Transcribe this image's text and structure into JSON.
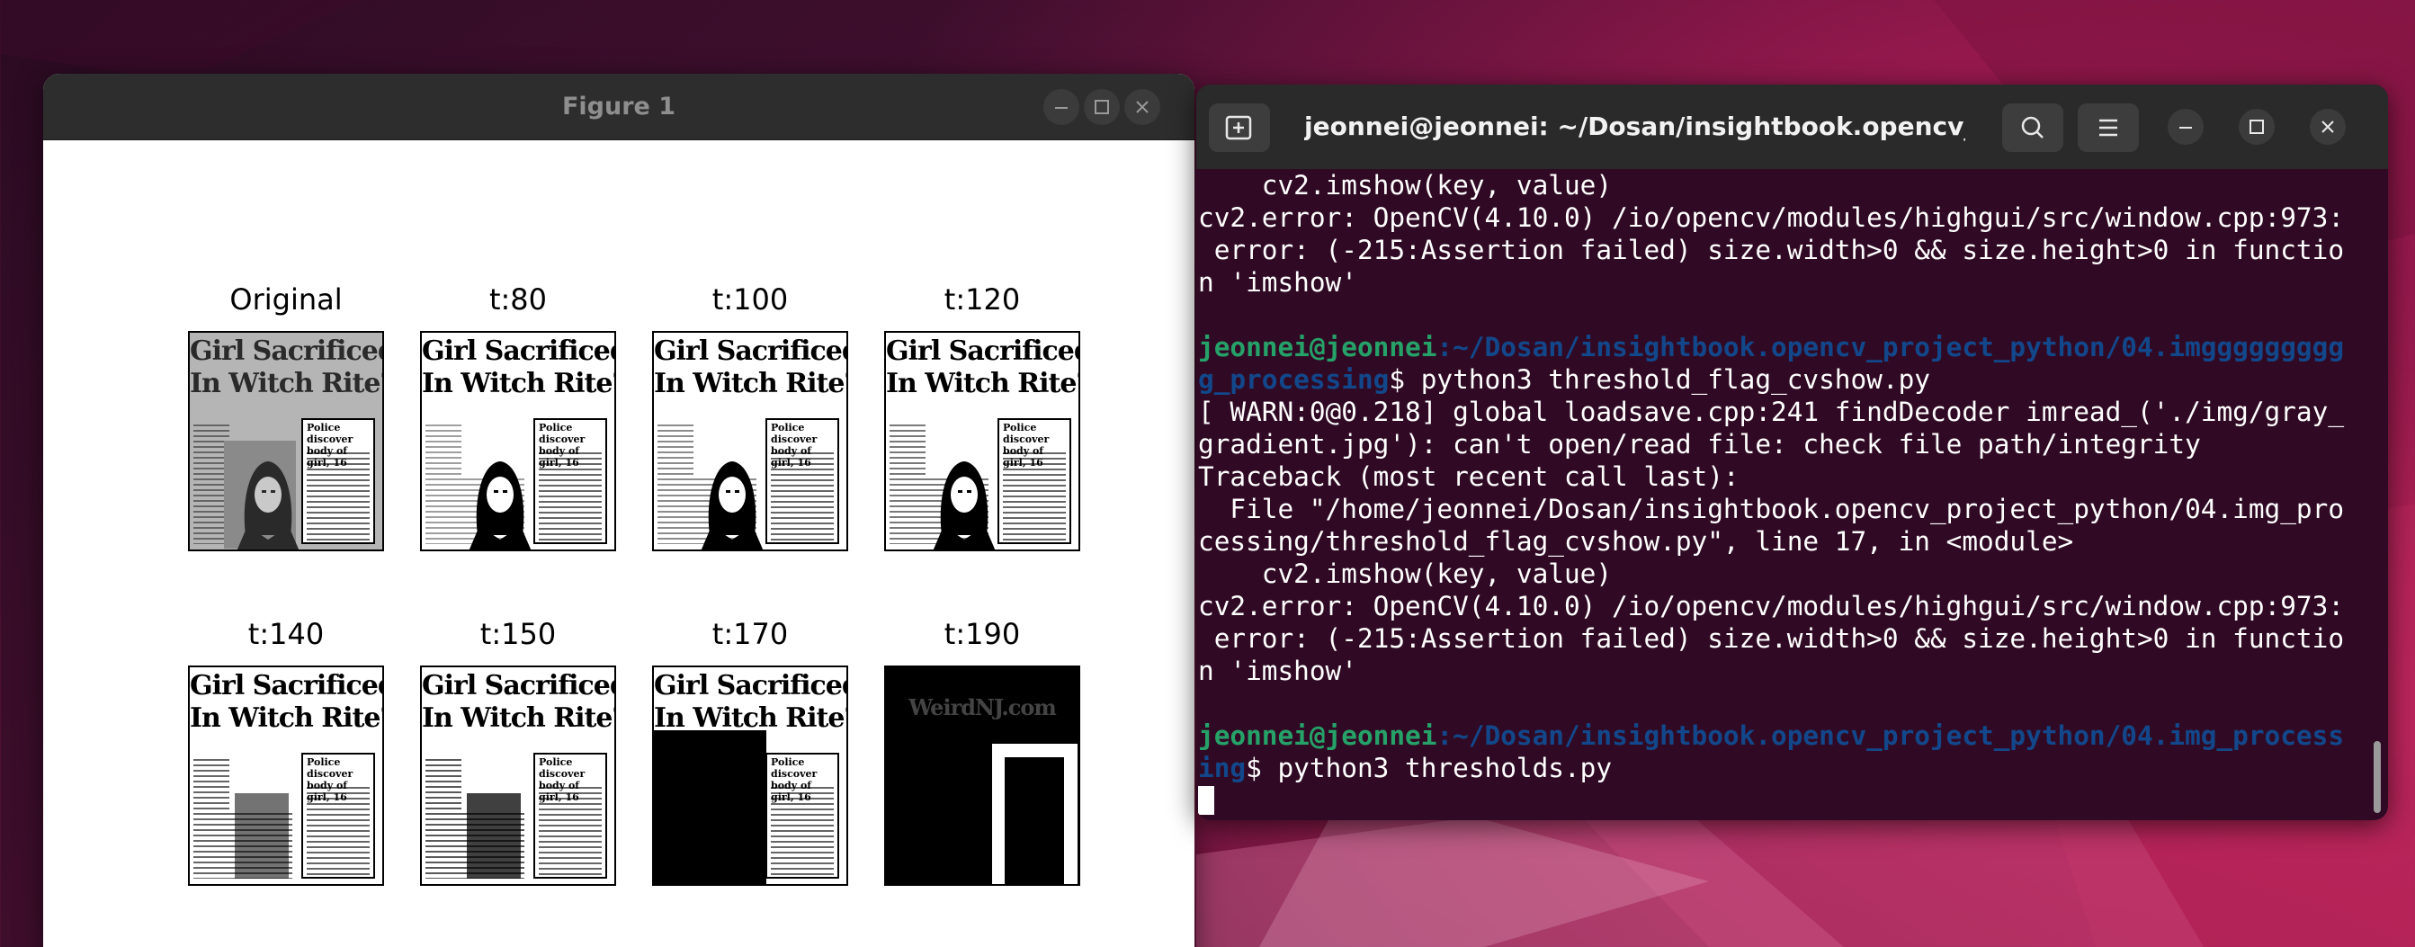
{
  "figure_window": {
    "title": "Figure 1",
    "thumbnails": [
      {
        "label": "Original",
        "headline1": "Girl Sacrificed",
        "headline2": "In Witch Rite?",
        "box_text": "Police discover\nbody of girl, 16",
        "variant": "gray"
      },
      {
        "label": "t:80",
        "headline1": "Girl Sacrificed",
        "headline2": "In Witch Rite?",
        "box_text": "Police discover\nbody of girl, 16",
        "variant": "t80"
      },
      {
        "label": "t:100",
        "headline1": "Girl Sacrificed",
        "headline2": "In Witch Rite?",
        "box_text": "Police discover\nbody of girl, 16",
        "variant": "t100"
      },
      {
        "label": "t:120",
        "headline1": "Girl Sacrificed",
        "headline2": "In Witch Rite?",
        "box_text": "Police discover\nbody of girl, 16",
        "variant": "t120"
      },
      {
        "label": "t:140",
        "headline1": "Girl Sacrificed",
        "headline2": "In Witch Rite?",
        "box_text": "Police discover\nbody of girl, 16",
        "variant": "t140"
      },
      {
        "label": "t:150",
        "headline1": "Girl Sacrificed",
        "headline2": "In Witch Rite?",
        "box_text": "Police discover\nbody of girl, 16",
        "variant": "t150"
      },
      {
        "label": "t:170",
        "headline1": "Girl Sacrificed",
        "headline2": "In Witch Rite?",
        "box_text": "Police discover\nbody of girl, 16",
        "variant": "t170"
      },
      {
        "label": "t:190",
        "headline1": "WeirdNJ.com",
        "headline2": "",
        "box_text": "",
        "variant": "t190"
      }
    ]
  },
  "terminal_window": {
    "title": "jeonnei@jeonnei: ~/Dosan/insightbook.opencv_pr...",
    "lines": [
      {
        "text": "    cv2.imshow(key, value)"
      },
      {
        "text": "cv2.error: OpenCV(4.10.0) /io/opencv/modules/highgui/src/window.cpp:973:"
      },
      {
        "text": " error: (-215:Assertion failed) size.width>0 && size.height>0 in functio"
      },
      {
        "text": "n 'imshow'"
      },
      {
        "text": ""
      },
      {
        "user": "jeonnei@jeonnei",
        "path": ":~/Dosan/insightbook.opencv_project_python/04.imggggggggg"
      },
      {
        "path": "g_processing",
        "cmd": "$ python3 threshold_flag_cvshow.py"
      },
      {
        "text": "[ WARN:0@0.218] global loadsave.cpp:241 findDecoder imread_('./img/gray_"
      },
      {
        "text": "gradient.jpg'): can't open/read file: check file path/integrity"
      },
      {
        "text": "Traceback (most recent call last):"
      },
      {
        "text": "  File \"/home/jeonnei/Dosan/insightbook.opencv_project_python/04.img_pro"
      },
      {
        "text": "cessing/threshold_flag_cvshow.py\", line 17, in <module>"
      },
      {
        "text": "    cv2.imshow(key, value)"
      },
      {
        "text": "cv2.error: OpenCV(4.10.0) /io/opencv/modules/highgui/src/window.cpp:973:"
      },
      {
        "text": " error: (-215:Assertion failed) size.width>0 && size.height>0 in functio"
      },
      {
        "text": "n 'imshow'"
      },
      {
        "text": ""
      },
      {
        "user": "jeonnei@jeonnei",
        "path": ":~/Dosan/insightbook.opencv_project_python/04.img_process"
      },
      {
        "path": "ing",
        "cmd": "$ python3 thresholds.py"
      },
      {
        "cursor": true
      }
    ]
  },
  "colors": {
    "terminal_bg": "#300a24",
    "prompt_user": "#26a269",
    "prompt_path": "#12488b",
    "titlebar": "#2d2d2d"
  }
}
